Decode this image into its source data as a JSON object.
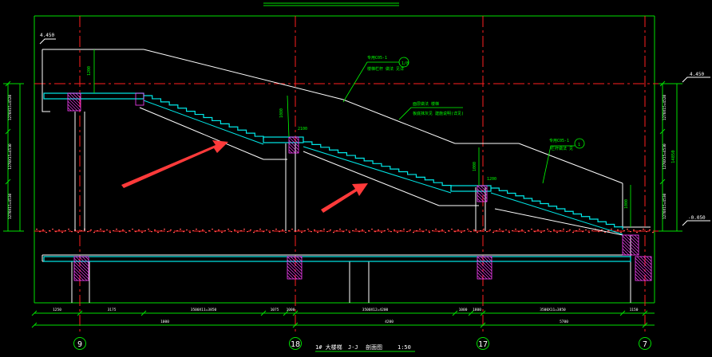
{
  "drawing": {
    "title": "1# 大楼梯",
    "section": "J-J",
    "section_suffix": "剖面图",
    "scale": "1:50"
  },
  "axes": [
    {
      "label": "9"
    },
    {
      "label": "18"
    },
    {
      "label": "17"
    },
    {
      "label": "7"
    }
  ],
  "dimensions_bottom_row1": [
    "1250",
    "3175",
    "3500X11=3850",
    "1075",
    "1000",
    "3500X12=4200",
    "1000",
    "1800",
    "3500X11=3850",
    "1150"
  ],
  "dimensions_bottom_row2": [
    "1000",
    "4200",
    "5700"
  ],
  "dimensions_left": [
    "1270X15=4520",
    "1270X15=4530",
    "1270X15=4530"
  ],
  "dimensions_right": [
    "1270X15=4520",
    "1270X15=4530",
    "1270X15=4530"
  ],
  "right_total": "14850",
  "levels": {
    "top_right": "4.450",
    "bottom_right": "-0.050",
    "top_left": "4.450"
  },
  "callouts": [
    {
      "ref": "专用C05-1",
      "detail": "楼梯栏杆 做法 见详",
      "circle": "1/8"
    },
    {
      "ref": "面层做法 楼梯",
      "detail": "板底抹灰见 建施说明(详见)",
      "circle": ""
    },
    {
      "ref": "专用C05-1",
      "detail": "栏杆做法 见",
      "circle": "1"
    }
  ],
  "small_dims": [
    "1200",
    "1080",
    "2100",
    "1000",
    "1200",
    "1000"
  ],
  "colors": {
    "background": "#000000",
    "line": "#ffffff",
    "axis": "#ff2020",
    "dimension": "#00e000",
    "stair": "#00e8e8",
    "hatch": "#ff40ff",
    "arrow": "#ff3a3a",
    "callout": "#00ff00"
  }
}
